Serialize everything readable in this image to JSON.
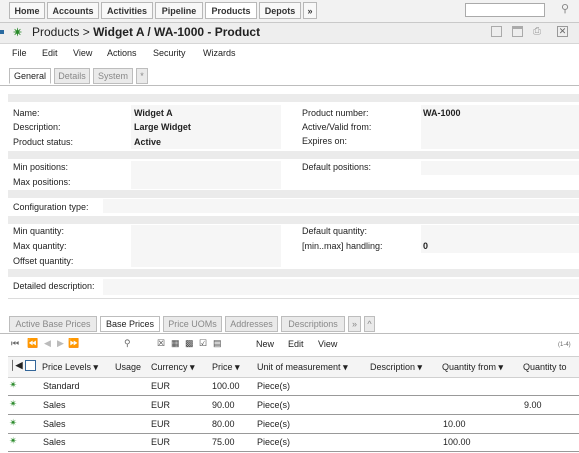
{
  "nav": {
    "tabs": [
      "Home",
      "Accounts",
      "Activities",
      "Pipeline",
      "Products",
      "Depots"
    ],
    "more": "»",
    "search_value": "",
    "search_icon": "magnifier-icon"
  },
  "titlebar": {
    "breadcrumb": "Products",
    "separator": ">",
    "title": "Widget A / WA-1000 - Product"
  },
  "menu": [
    "File",
    "Edit",
    "View",
    "Actions",
    "Security",
    "Wizards"
  ],
  "detail_tabs": [
    "General",
    "Details",
    "System",
    "*"
  ],
  "form": {
    "name_label": "Name:",
    "name_value": "Widget A",
    "description_label": "Description:",
    "description_value": "Large Widget",
    "status_label": "Product status:",
    "status_value": "Active",
    "product_number_label": "Product number:",
    "product_number_value": "WA-1000",
    "active_from_label": "Active/Valid from:",
    "expires_label": "Expires on:",
    "min_positions_label": "Min positions:",
    "max_positions_label": "Max positions:",
    "default_positions_label": "Default positions:",
    "config_type_label": "Configuration type:",
    "min_quantity_label": "Min quantity:",
    "max_quantity_label": "Max quantity:",
    "offset_quantity_label": "Offset quantity:",
    "default_quantity_label": "Default quantity:",
    "minmax_label": "[min..max] handling:",
    "minmax_value": "0",
    "detailed_description_label": "Detailed description:"
  },
  "bottom_tabs": [
    "Active Base Prices",
    "Base Prices",
    "Price UOMs",
    "Addresses",
    "Descriptions",
    "»",
    "^"
  ],
  "toolbar": {
    "new": "New",
    "edit": "Edit",
    "view": "View",
    "range": "(1-4)"
  },
  "table": {
    "columns": [
      "Price Levels",
      "Usage",
      "Currency",
      "Price",
      "Unit of measurement",
      "Description",
      "Quantity from",
      "Quantity to"
    ],
    "rows": [
      {
        "level": "Standard",
        "usage": "",
        "currency": "EUR",
        "price": "100.00",
        "unit": "Piece(s)",
        "description": "",
        "qfrom": "",
        "qto": ""
      },
      {
        "level": "Sales",
        "usage": "",
        "currency": "EUR",
        "price": "90.00",
        "unit": "Piece(s)",
        "description": "",
        "qfrom": "",
        "qto": "9.00"
      },
      {
        "level": "Sales",
        "usage": "",
        "currency": "EUR",
        "price": "80.00",
        "unit": "Piece(s)",
        "description": "",
        "qfrom": "10.00",
        "qto": ""
      },
      {
        "level": "Sales",
        "usage": "",
        "currency": "EUR",
        "price": "75.00",
        "unit": "Piece(s)",
        "description": "",
        "qfrom": "100.00",
        "qto": ""
      }
    ]
  }
}
